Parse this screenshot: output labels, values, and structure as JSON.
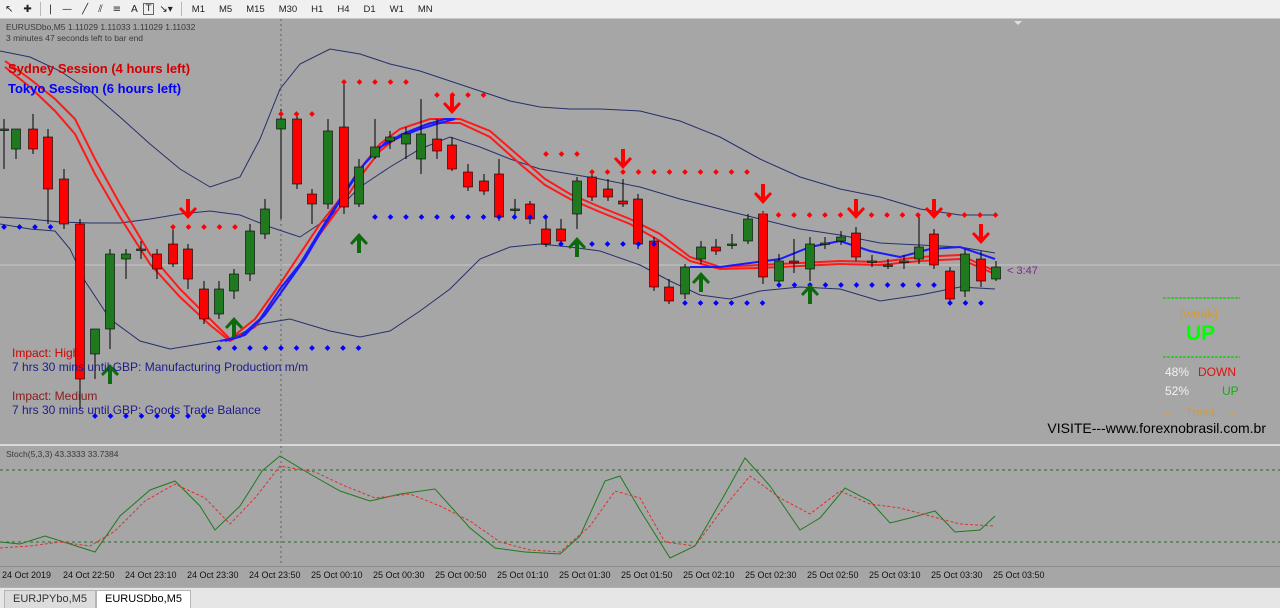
{
  "toolbar": {
    "timeframes": [
      "M1",
      "M5",
      "M15",
      "M30",
      "H1",
      "H4",
      "D1",
      "W1",
      "MN"
    ],
    "text_tool": "A",
    "label_tool": "T"
  },
  "chart": {
    "symbol_line": "EURUSDbo,M5  1.11029 1.11033 1.11029 1.11032",
    "bar_timer": "3 minutes 47 seconds left to bar end",
    "sydney": "Sydney Session (4 hours left)",
    "tokyo": "Tokyo Session (6 hours left)",
    "news": [
      {
        "impact": "Impact: High",
        "event": "7 hrs 30 mins until GBP: Manufacturing Production m/m"
      },
      {
        "impact": "Impact: Medium",
        "event": "7 hrs 30 mins until GBP: Goods Trade Balance"
      }
    ],
    "price_countdown": "< 3:47",
    "colors": {
      "bull": "#1f7a1f",
      "bear": "#ff0000",
      "tokyo": "#0000ff",
      "sydney": "#d10000",
      "arrow_up": "#0d6b0d",
      "arrow_down": "#ff0000"
    }
  },
  "signal_panel": {
    "strength": "[weak]",
    "direction": "UP",
    "down_pct": "48%",
    "down_label": "DOWN",
    "up_pct": "52%",
    "up_label": "UP",
    "trend_label": "Trend"
  },
  "visite": "VISITE---www.forexnobrasil.com.br",
  "stoch": {
    "label": "Stoch(5,3,3) 43.3333 33.7384"
  },
  "time_axis": [
    "24 Oct 2019",
    "24 Oct 22:50",
    "24 Oct 23:10",
    "24 Oct 23:30",
    "24 Oct 23:50",
    "25 Oct 00:10",
    "25 Oct 00:30",
    "25 Oct 00:50",
    "25 Oct 01:10",
    "25 Oct 01:30",
    "25 Oct 01:50",
    "25 Oct 02:10",
    "25 Oct 02:30",
    "25 Oct 02:50",
    "25 Oct 03:10",
    "25 Oct 03:30",
    "25 Oct 03:50"
  ],
  "tabs": [
    "EURJPYbo,M5",
    "EURUSDbo,M5"
  ]
}
